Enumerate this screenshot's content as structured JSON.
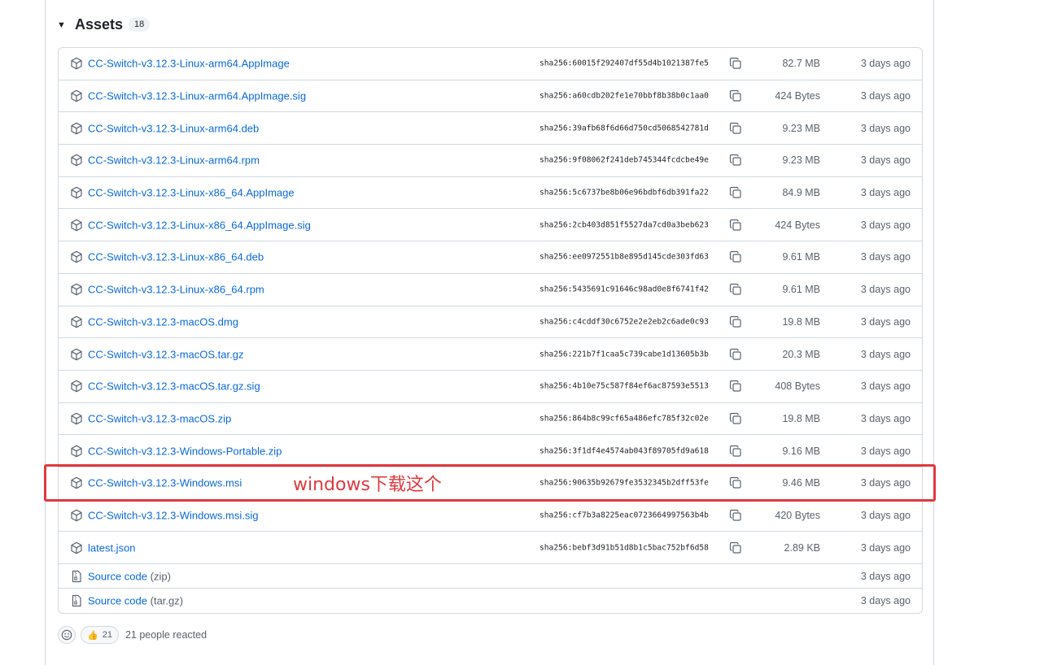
{
  "assets": {
    "title": "Assets",
    "count": "18",
    "rows": [
      {
        "name": "CC-Switch-v3.12.3-Linux-arm64.AppImage",
        "sha": "sha256:60015f292407df55d4b1021387fe5",
        "size": "82.7 MB",
        "date": "3 days ago"
      },
      {
        "name": "CC-Switch-v3.12.3-Linux-arm64.AppImage.sig",
        "sha": "sha256:a60cdb202fe1e70bbf8b38b0c1aa0",
        "size": "424 Bytes",
        "date": "3 days ago"
      },
      {
        "name": "CC-Switch-v3.12.3-Linux-arm64.deb",
        "sha": "sha256:39afb68f6d66d750cd5068542781d",
        "size": "9.23 MB",
        "date": "3 days ago"
      },
      {
        "name": "CC-Switch-v3.12.3-Linux-arm64.rpm",
        "sha": "sha256:9f08062f241deb745344fcdcbe49e",
        "size": "9.23 MB",
        "date": "3 days ago"
      },
      {
        "name": "CC-Switch-v3.12.3-Linux-x86_64.AppImage",
        "sha": "sha256:5c6737be8b06e96bdbf6db391fa22",
        "size": "84.9 MB",
        "date": "3 days ago"
      },
      {
        "name": "CC-Switch-v3.12.3-Linux-x86_64.AppImage.sig",
        "sha": "sha256:2cb403d851f5527da7cd0a3beb623",
        "size": "424 Bytes",
        "date": "3 days ago"
      },
      {
        "name": "CC-Switch-v3.12.3-Linux-x86_64.deb",
        "sha": "sha256:ee0972551b8e895d145cde303fd63",
        "size": "9.61 MB",
        "date": "3 days ago"
      },
      {
        "name": "CC-Switch-v3.12.3-Linux-x86_64.rpm",
        "sha": "sha256:5435691c91646c98ad0e8f6741f42",
        "size": "9.61 MB",
        "date": "3 days ago"
      },
      {
        "name": "CC-Switch-v3.12.3-macOS.dmg",
        "sha": "sha256:c4cddf30c6752e2e2eb2c6ade0c93",
        "size": "19.8 MB",
        "date": "3 days ago"
      },
      {
        "name": "CC-Switch-v3.12.3-macOS.tar.gz",
        "sha": "sha256:221b7f1caa5c739cabe1d13605b3b",
        "size": "20.3 MB",
        "date": "3 days ago"
      },
      {
        "name": "CC-Switch-v3.12.3-macOS.tar.gz.sig",
        "sha": "sha256:4b10e75c587f84ef6ac87593e5513",
        "size": "408 Bytes",
        "date": "3 days ago"
      },
      {
        "name": "CC-Switch-v3.12.3-macOS.zip",
        "sha": "sha256:864b8c99cf65a486efc785f32c02e",
        "size": "19.8 MB",
        "date": "3 days ago"
      },
      {
        "name": "CC-Switch-v3.12.3-Windows-Portable.zip",
        "sha": "sha256:3f1df4e4574ab043f89705fd9a618",
        "size": "9.16 MB",
        "date": "3 days ago"
      },
      {
        "name": "CC-Switch-v3.12.3-Windows.msi",
        "sha": "sha256:90635b92679fe3532345b2dff53fe",
        "size": "9.46 MB",
        "date": "3 days ago"
      },
      {
        "name": "CC-Switch-v3.12.3-Windows.msi.sig",
        "sha": "sha256:cf7b3a8225eac0723664997563b4b",
        "size": "420 Bytes",
        "date": "3 days ago"
      },
      {
        "name": "latest.json",
        "sha": "sha256:bebf3d91b51d8b1c5bac752bf6d58",
        "size": "2.89 KB",
        "date": "3 days ago"
      }
    ],
    "source_rows": [
      {
        "name": "Source code",
        "format": "(zip)",
        "date": "3 days ago"
      },
      {
        "name": "Source code",
        "format": "(tar.gz)",
        "date": "3 days ago"
      }
    ]
  },
  "annotation": {
    "text": "windows下载这个",
    "color": "#e0393e"
  },
  "reactions": {
    "emoji": "👍",
    "count": "21",
    "summary": "21 people reacted"
  },
  "colors": {
    "link": "#0969da",
    "muted": "#59636e",
    "border": "#d1d9e0"
  }
}
